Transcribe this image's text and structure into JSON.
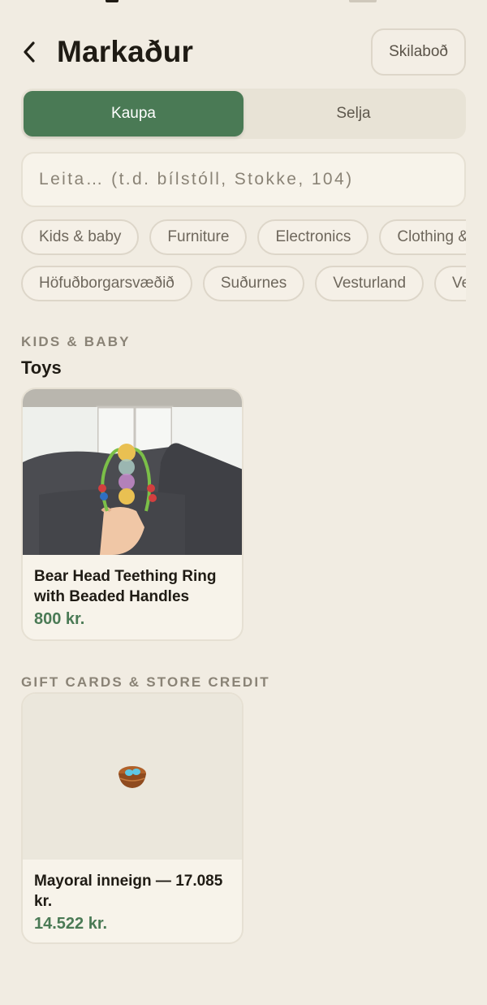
{
  "header": {
    "title": "Markaður",
    "messages_label": "Skilaboð"
  },
  "segment": {
    "buy_label": "Kaupa",
    "sell_label": "Selja",
    "active": "buy"
  },
  "search": {
    "placeholder": "Leita… (t.d. bílstóll, Stokke, 104)",
    "value": ""
  },
  "category_chips": [
    "Kids & baby",
    "Furniture",
    "Electronics",
    "Clothing &"
  ],
  "region_chips": [
    "Höfuðborgarsvæðið",
    "Suðurnes",
    "Vesturland",
    "Ve"
  ],
  "sections": [
    {
      "label": "KIDS & BABY",
      "subcategory": "Toys",
      "listing": {
        "title": "Bear Head Teething Ring with Beaded Handles",
        "price": "800 kr."
      }
    },
    {
      "label": "GIFT CARDS & STORE CREDIT",
      "listing": {
        "title": "Mayoral inneign — 17.085 kr.",
        "price": "14.522 kr."
      }
    }
  ],
  "colors": {
    "background": "#f1ece2",
    "accent_green": "#4a7a55",
    "text_dark": "#1f1b14",
    "muted": "#8a8376"
  },
  "icons": {
    "back": "chevron-left-icon",
    "nest": "nest-icon"
  }
}
